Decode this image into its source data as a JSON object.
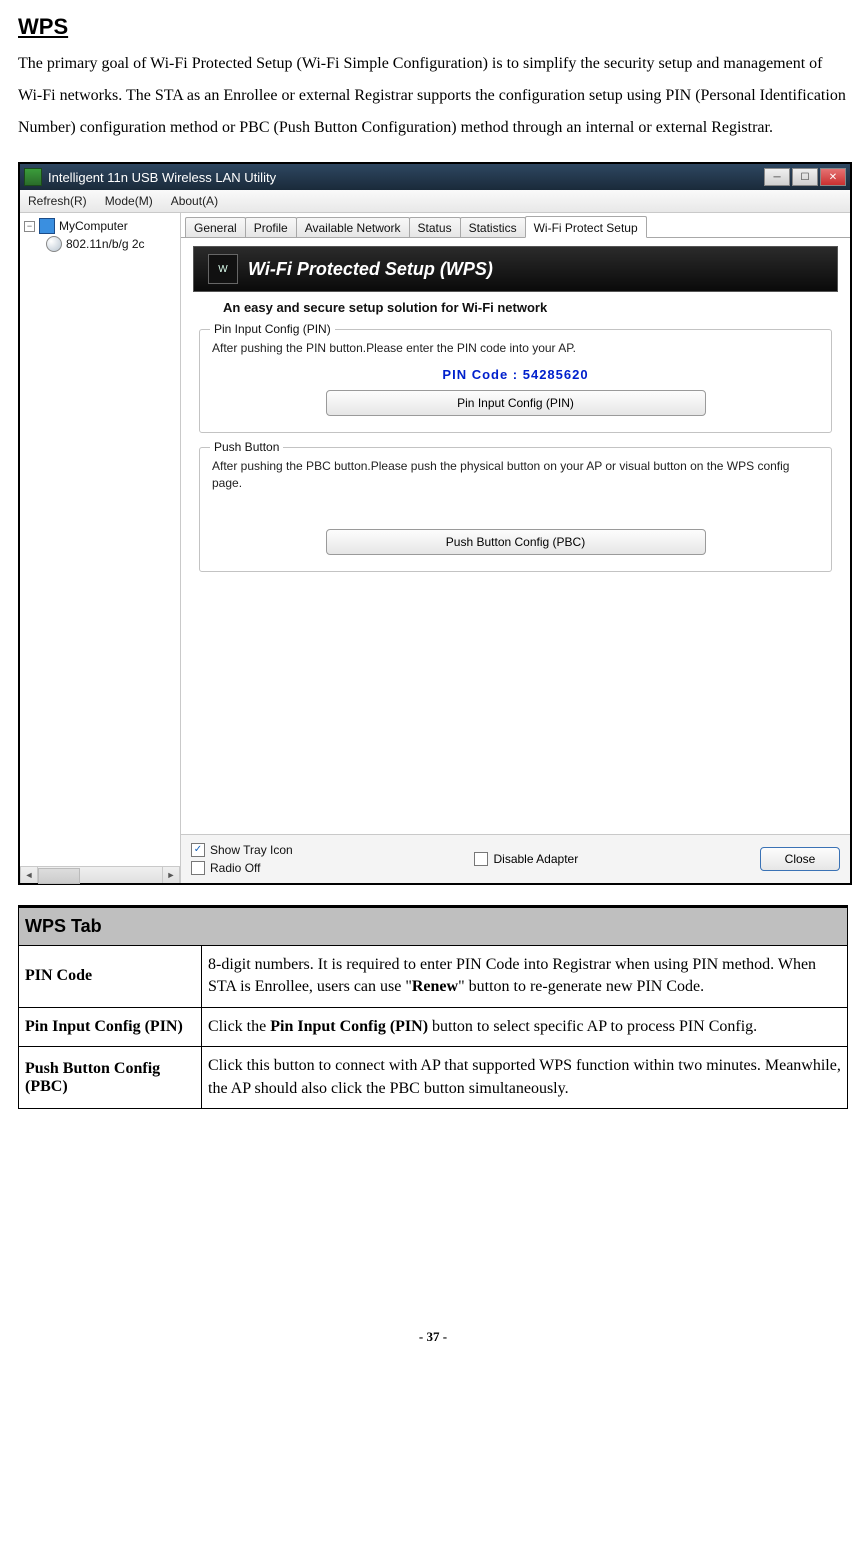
{
  "page": {
    "title": "WPS",
    "intro": "The primary goal of Wi-Fi Protected Setup (Wi-Fi Simple Configuration) is to simplify the security setup and management of Wi-Fi networks. The STA as an Enrollee or external Registrar supports the configuration setup using PIN (Personal Identification Number) configuration method or PBC (Push Button Configuration) method through an internal or external Registrar.",
    "footer": "- 37 -"
  },
  "window": {
    "title": "Intelligent 11n USB Wireless LAN Utility",
    "menu": {
      "refresh": "Refresh(R)",
      "mode": "Mode(M)",
      "about": "About(A)"
    },
    "tree": {
      "root": "MyComputer",
      "child": "802.11n/b/g 2c"
    },
    "tabs": [
      "General",
      "Profile",
      "Available Network",
      "Status",
      "Statistics",
      "Wi-Fi Protect Setup"
    ],
    "active_tab": 5,
    "wps": {
      "banner": "Wi-Fi Protected Setup (WPS)",
      "subtitle": "An easy and secure setup solution for Wi-Fi network",
      "pin": {
        "legend": "Pin Input Config (PIN)",
        "text": "After pushing the PIN button.Please enter the PIN code into your AP.",
        "code_label": "PIN Code :  54285620",
        "button": "Pin Input Config (PIN)"
      },
      "pbc": {
        "legend": "Push Button",
        "text": "After pushing the PBC button.Please push the physical button on your AP or visual button on the WPS config page.",
        "button": "Push Button Config (PBC)"
      }
    },
    "footer": {
      "show_tray": "Show Tray Icon",
      "radio_off": "Radio Off",
      "disable_adapter": "Disable Adapter",
      "close": "Close"
    }
  },
  "table": {
    "header": "WPS Tab",
    "rows": [
      {
        "label": "PIN Code",
        "value_pre": "8-digit numbers. It is required to enter PIN Code into Registrar when using PIN method. When STA is Enrollee, users can use \"",
        "value_bold": "Renew",
        "value_post": "\" button to re-generate new PIN Code."
      },
      {
        "label": "Pin Input Config (PIN)",
        "value_pre": "Click the ",
        "value_bold": "Pin Input Config (PIN)",
        "value_post": " button to select specific AP to process PIN Config."
      },
      {
        "label": "Push Button Config (PBC)",
        "value_pre": "Click this button to connect with AP that supported WPS function within two minutes. Meanwhile, the AP should also click the PBC button simultaneously.",
        "value_bold": "",
        "value_post": ""
      }
    ]
  }
}
